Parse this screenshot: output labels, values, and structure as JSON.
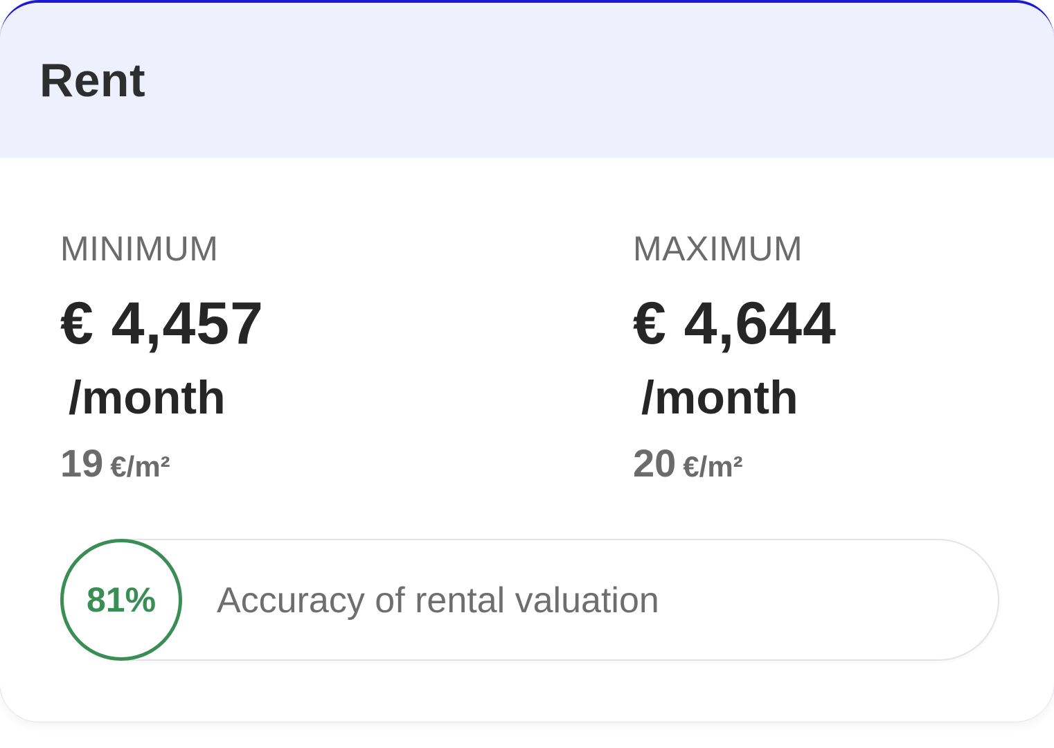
{
  "card": {
    "title": "Rent",
    "accent_color": "#1a1ad6",
    "header_bg": "#eef0fd"
  },
  "minimum": {
    "label": "MINIMUM",
    "price": "€ 4,457",
    "period": "/month",
    "per_sqm_value": "19",
    "per_sqm_unit": "€/m²"
  },
  "maximum": {
    "label": "MAXIMUM",
    "price": "€ 4,644",
    "period": "/month",
    "per_sqm_value": "20",
    "per_sqm_unit": "€/m²"
  },
  "accuracy": {
    "value": "81%",
    "label": "Accuracy of rental valuation",
    "color": "#3a8d55"
  }
}
